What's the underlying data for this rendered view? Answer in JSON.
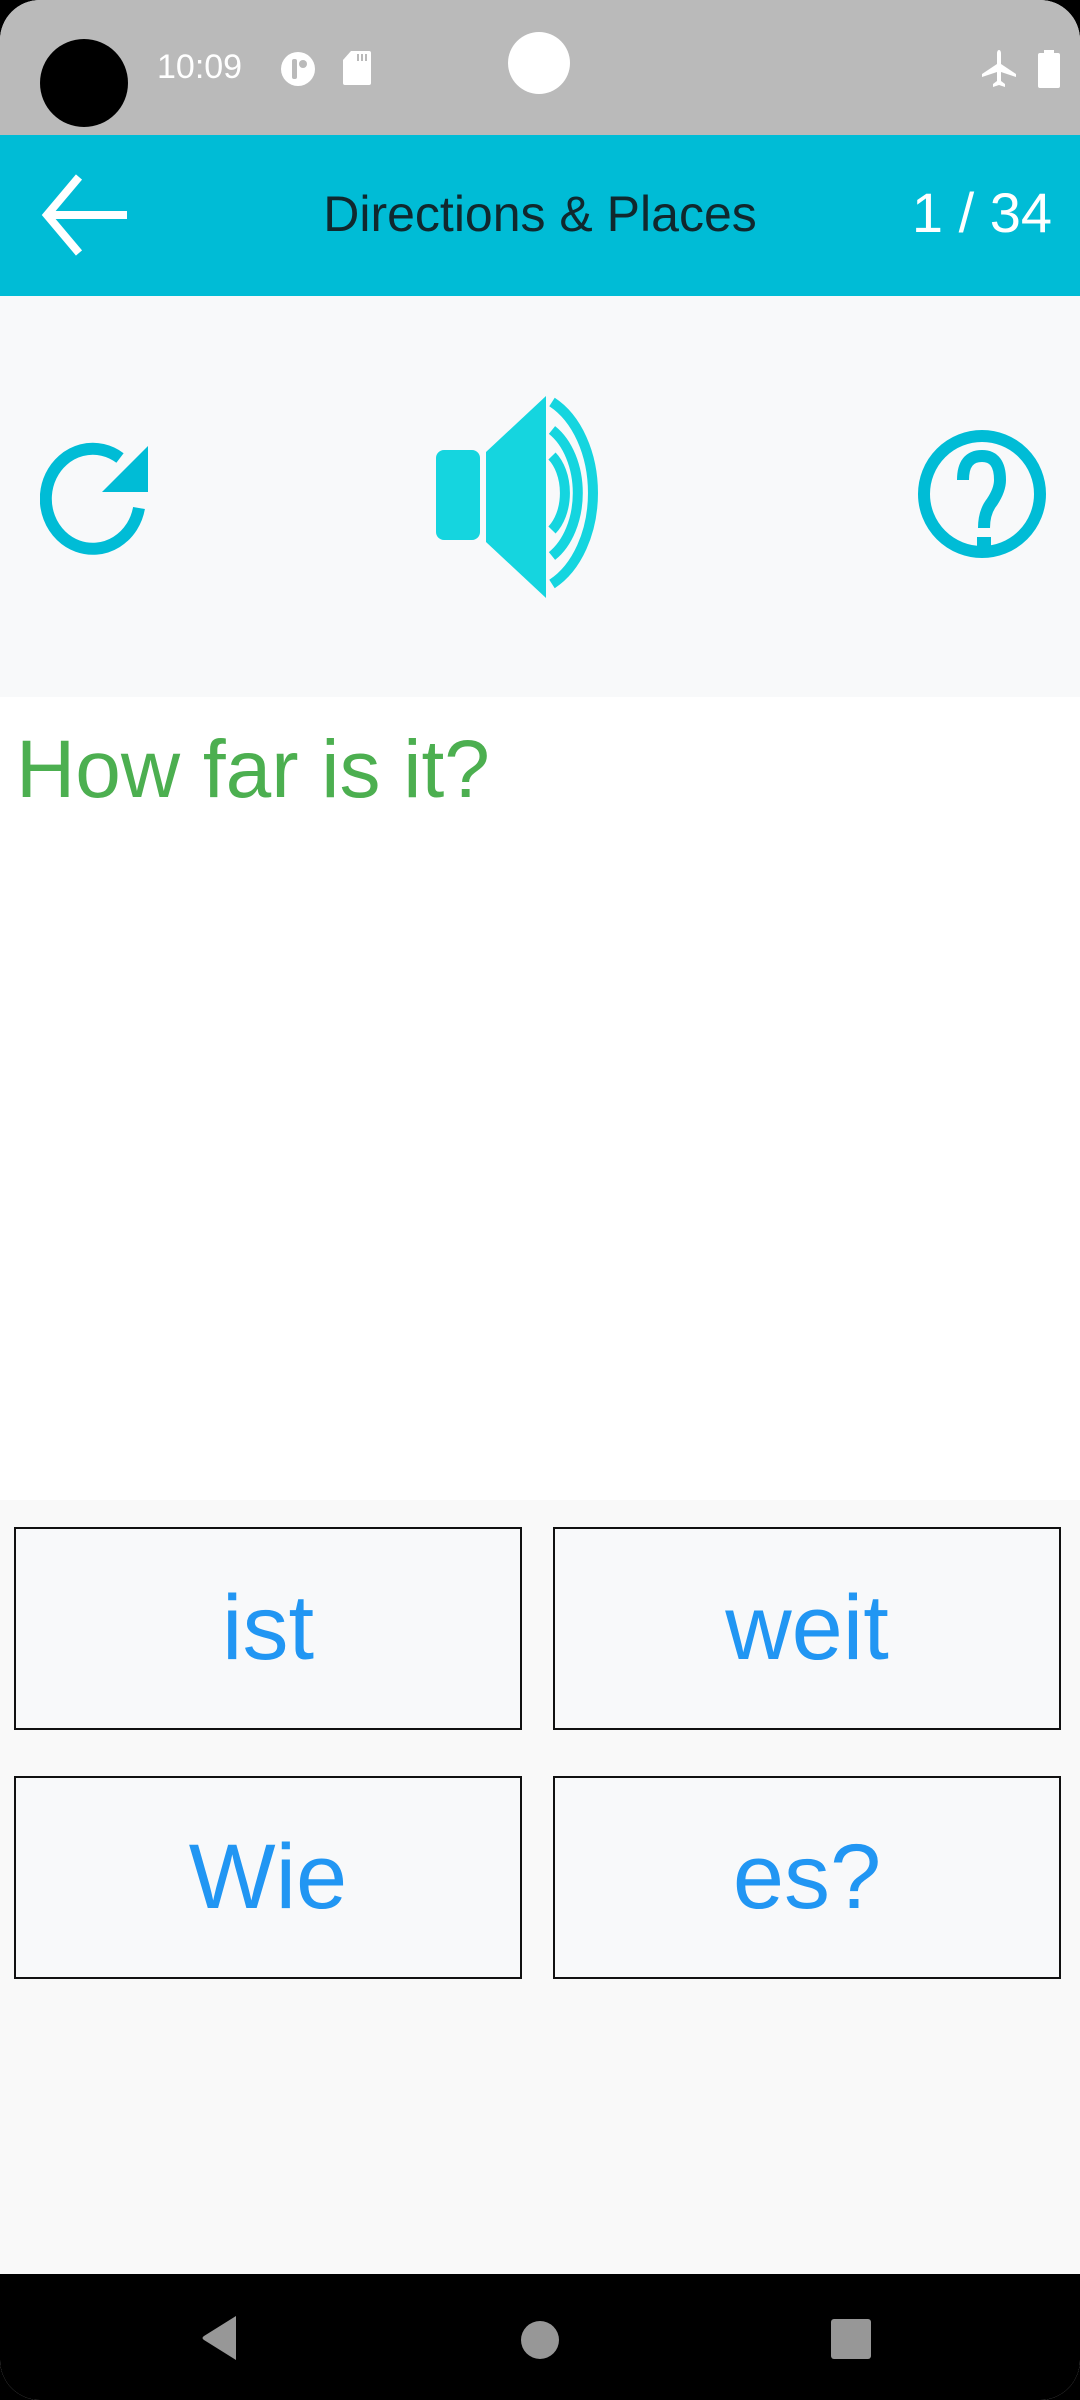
{
  "status_bar": {
    "time": "10:09",
    "icons": [
      "app-notification-icon",
      "sd-card-icon",
      "airplane-mode-icon",
      "battery-icon"
    ]
  },
  "app_bar": {
    "back_icon": "arrow-left-icon",
    "title": "Directions & Places",
    "progress": "1 / 34",
    "current_index": 1,
    "total": 34
  },
  "tools": {
    "left": "replay-icon",
    "center": "speaker-icon",
    "right": "help-icon"
  },
  "question": {
    "text": "How far is it?"
  },
  "answers": [
    {
      "label": "ist"
    },
    {
      "label": "weit"
    },
    {
      "label": "Wie"
    },
    {
      "label": "es?"
    }
  ],
  "colors": {
    "app_bar": "#00bcd6",
    "icon_accent": "#12d3de",
    "question_text": "#4caf50",
    "answer_text": "#2196f3"
  },
  "nav_bar": {
    "buttons": [
      "back-triangle-icon",
      "home-circle-icon",
      "recents-square-icon"
    ]
  }
}
